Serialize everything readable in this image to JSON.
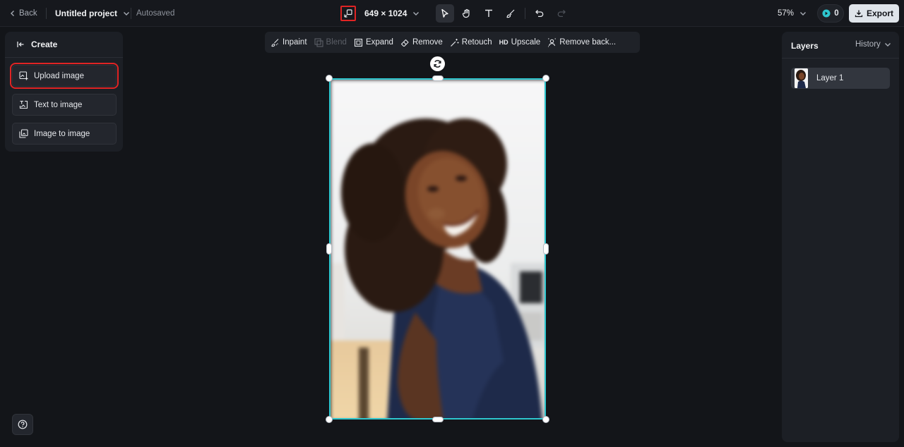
{
  "topbar": {
    "back_label": "Back",
    "project_title": "Untitled project",
    "autosave_status": "Autosaved",
    "canvas_size": "649 × 1024",
    "zoom_level": "57%",
    "credits": "0",
    "export_label": "Export",
    "tools": [
      "select-icon",
      "hand-icon",
      "text-icon",
      "brush-icon",
      "undo-icon",
      "redo-icon"
    ]
  },
  "left_panel": {
    "title": "Create",
    "items": [
      {
        "label": "Upload image",
        "icon": "upload-image-icon"
      },
      {
        "label": "Text to image",
        "icon": "text-to-image-icon"
      },
      {
        "label": "Image to image",
        "icon": "image-to-image-icon"
      }
    ]
  },
  "edit_toolbar": {
    "items": [
      {
        "label": "Inpaint",
        "enabled": true
      },
      {
        "label": "Blend",
        "enabled": false
      },
      {
        "label": "Expand",
        "enabled": true
      },
      {
        "label": "Remove",
        "enabled": true
      },
      {
        "label": "Retouch",
        "enabled": true
      },
      {
        "label": "Upscale",
        "enabled": true,
        "prefix": "HD"
      },
      {
        "label": "Remove back...",
        "enabled": true
      }
    ]
  },
  "right_panel": {
    "title": "Layers",
    "history_label": "History",
    "layers": [
      {
        "label": "Layer 1"
      }
    ]
  },
  "colors": {
    "background": "#131519",
    "selection": "#2ec7cf",
    "highlight": "#e02424",
    "export_button": "#dfe4ea"
  }
}
